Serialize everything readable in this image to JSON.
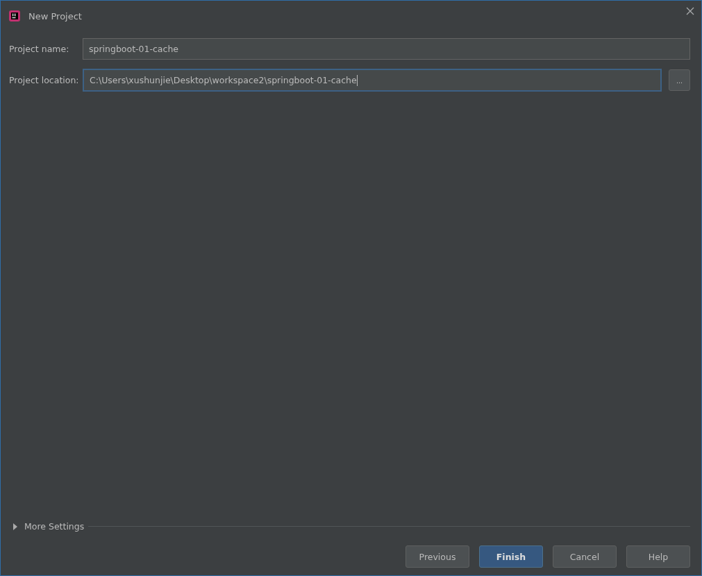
{
  "window": {
    "title": "New Project"
  },
  "fields": [
    {
      "label": "Project name:",
      "value": "springboot-01-cache",
      "focused": false
    },
    {
      "label": "Project location:",
      "value": "C:\\Users\\xushunjie\\Desktop\\workspace2\\springboot-01-cache",
      "focused": true,
      "browse": "..."
    }
  ],
  "more_settings": {
    "label": "More Settings",
    "expanded": false
  },
  "buttons": [
    {
      "label": "Previous",
      "default": false
    },
    {
      "label": "Finish",
      "default": true
    },
    {
      "label": "Cancel",
      "default": false
    },
    {
      "label": "Help",
      "default": false
    }
  ]
}
